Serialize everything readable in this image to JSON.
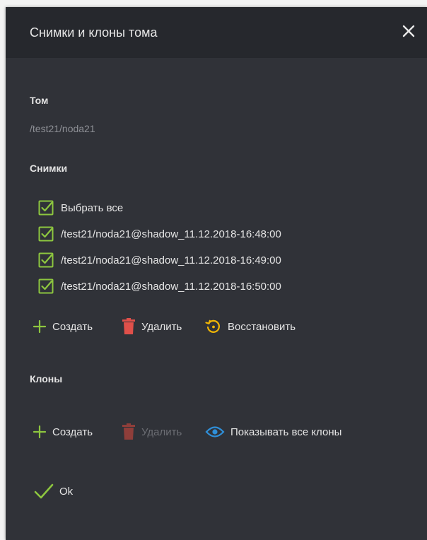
{
  "dialog": {
    "title": "Снимки и клоны тома",
    "close_icon": "close-icon"
  },
  "volume": {
    "label": "Том",
    "path": "/test21/noda21"
  },
  "snapshots": {
    "label": "Снимки",
    "select_all": "Выбрать все",
    "items": [
      "/test21/noda21@shadow_11.12.2018-16:48:00",
      "/test21/noda21@shadow_11.12.2018-16:49:00",
      "/test21/noda21@shadow_11.12.2018-16:50:00"
    ],
    "actions": {
      "create": "Создать",
      "delete": "Удалить",
      "restore": "Восстановить"
    }
  },
  "clones": {
    "label": "Клоны",
    "actions": {
      "create": "Создать",
      "delete": "Удалить",
      "show_all": "Показывать все клоны"
    }
  },
  "ok_label": "Ok",
  "colors": {
    "green": "#8dc63f",
    "red": "#e0504a",
    "restore_yellow": "#f2b705",
    "eye_blue": "#2f8fd8"
  }
}
